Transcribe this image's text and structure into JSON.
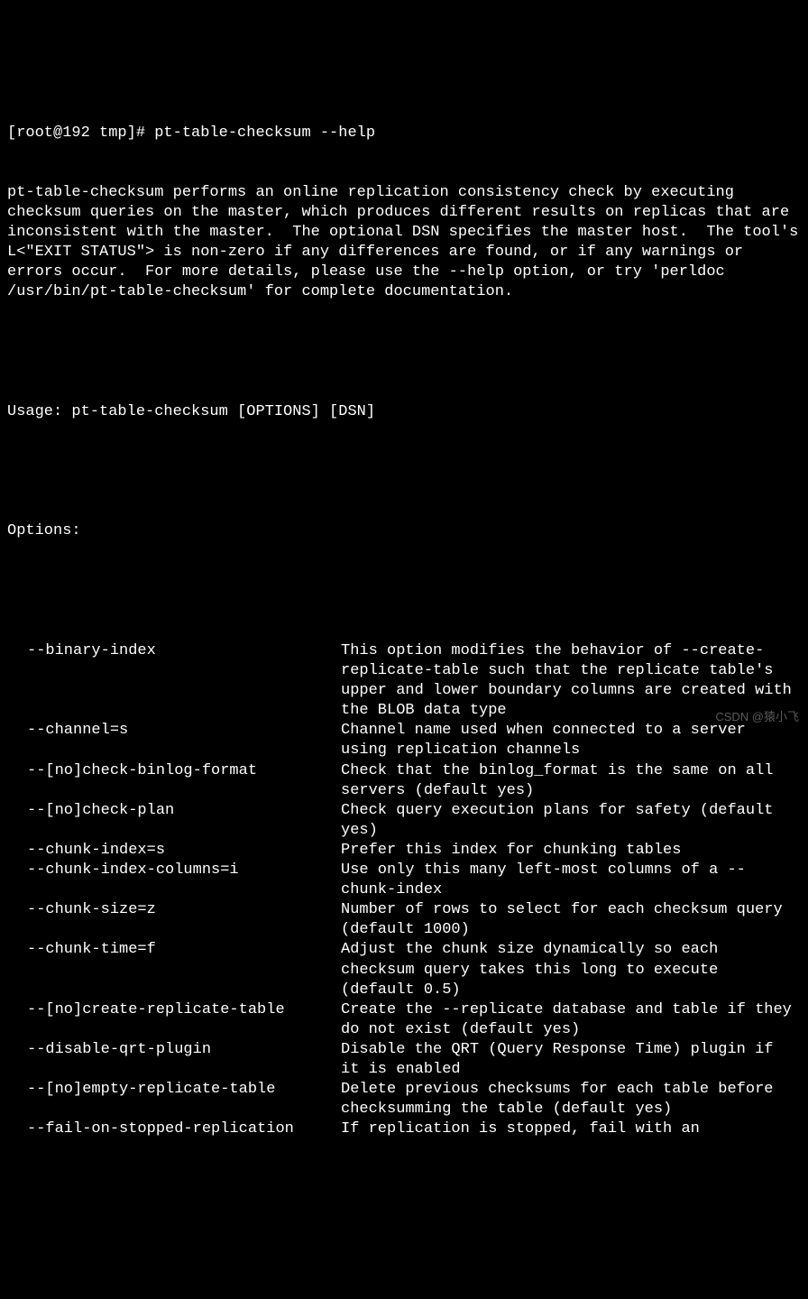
{
  "prompt": "[root@192 tmp]# pt-table-checksum --help",
  "description": "pt-table-checksum performs an online replication consistency check by executing checksum queries on the master, which produces different results on replicas that are inconsistent with the master.  The optional DSN specifies the master host.  The tool's L<\"EXIT STATUS\"> is non-zero if any differences are found, or if any warnings or errors occur.  For more details, please use the --help option, or try 'perldoc /usr/bin/pt-table-checksum' for complete documentation.",
  "usage": "Usage: pt-table-checksum [OPTIONS] [DSN]",
  "options_header": "Options:",
  "options": [
    {
      "name": "--binary-index",
      "desc": "This option modifies the behavior of --create-replicate-table such that the replicate table's upper and lower boundary columns are created with the BLOB data type"
    },
    {
      "name": "--channel=s",
      "desc": "Channel name used when connected to a server using replication channels"
    },
    {
      "name": "--[no]check-binlog-format",
      "desc": "Check that the binlog_format is the same on all servers (default yes)"
    },
    {
      "name": "--[no]check-plan",
      "desc": "Check query execution plans for safety (default yes)"
    },
    {
      "name": "--chunk-index=s",
      "desc": "Prefer this index for chunking tables"
    },
    {
      "name": "--chunk-index-columns=i",
      "desc": "Use only this many left-most columns of a --chunk-index"
    },
    {
      "name": "--chunk-size=z",
      "desc": "Number of rows to select for each checksum query (default 1000)"
    },
    {
      "name": "--chunk-time=f",
      "desc": "Adjust the chunk size dynamically so each checksum query takes this long to execute (default 0.5)"
    },
    {
      "name": "--[no]create-replicate-table",
      "desc": "Create the --replicate database and table if they do not exist (default yes)"
    },
    {
      "name": "--disable-qrt-plugin",
      "desc": "Disable the QRT (Query Response Time) plugin if it is enabled"
    },
    {
      "name": "--[no]empty-replicate-table",
      "desc": "Delete previous checksums for each table before checksumming the table (default yes)"
    },
    {
      "name": "--fail-on-stopped-replication",
      "desc": "If replication is stopped, fail with an"
    }
  ],
  "watermark": "CSDN @猿小飞"
}
